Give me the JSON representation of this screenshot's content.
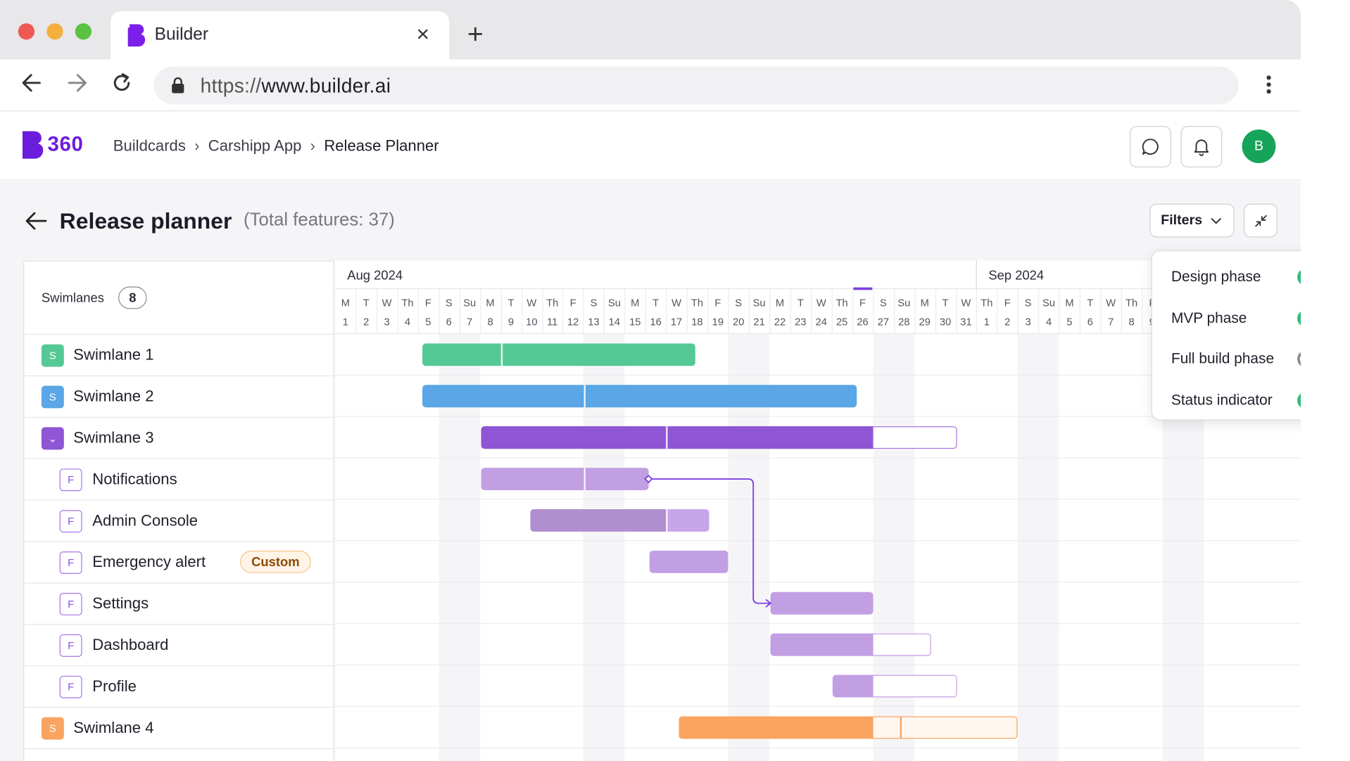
{
  "browser": {
    "tab_title": "Builder",
    "close_glyph": "×",
    "new_tab_glyph": "+",
    "url_scheme": "https://",
    "url_host": "www.builder.ai"
  },
  "app": {
    "brand_text": "360",
    "breadcrumb": [
      "Buildcards",
      "Carshipp App",
      "Release Planner"
    ],
    "avatar_initial": "B",
    "accent_color": "#6c1ddc"
  },
  "page": {
    "title": "Release planner",
    "subtitle": "(Total features: 37)",
    "filters_label": "Filters"
  },
  "lanes": {
    "header_label": "Swimlanes",
    "count": "8",
    "rows": [
      {
        "label": "Swimlane 1",
        "badge": "S",
        "kind": "lane",
        "color": "#55c995"
      },
      {
        "label": "Swimlane 2",
        "badge": "S",
        "kind": "lane",
        "color": "#5aa6e6"
      },
      {
        "label": "Swimlane 3",
        "badge": "⌄",
        "kind": "lane-expanded",
        "color": "#8e55d4"
      },
      {
        "label": "Notifications",
        "badge": "F",
        "kind": "feature"
      },
      {
        "label": "Admin Console",
        "badge": "F",
        "kind": "feature"
      },
      {
        "label": "Emergency alert",
        "badge": "F",
        "kind": "feature",
        "tag": "Custom"
      },
      {
        "label": "Settings",
        "badge": "F",
        "kind": "feature"
      },
      {
        "label": "Dashboard",
        "badge": "F",
        "kind": "feature"
      },
      {
        "label": "Profile",
        "badge": "F",
        "kind": "feature"
      },
      {
        "label": "Swimlane 4",
        "badge": "S",
        "kind": "lane",
        "color": "#f9a460"
      }
    ]
  },
  "timeline": {
    "months": [
      {
        "label": "Aug 2024",
        "start_index": 0
      },
      {
        "label": "Sep 2024",
        "start_index": 31
      }
    ],
    "weekdays": [
      "M",
      "T",
      "W",
      "Th",
      "F",
      "S",
      "Su",
      "M",
      "T",
      "W",
      "Th",
      "F",
      "S",
      "Su",
      "M",
      "T",
      "W",
      "Th",
      "F",
      "S",
      "Su",
      "M",
      "T",
      "W",
      "Th",
      "F",
      "S",
      "Su",
      "M",
      "T",
      "W",
      "Th",
      "F",
      "S",
      "Su",
      "M",
      "T",
      "W",
      "Th",
      "F"
    ],
    "day_numbers": [
      "1",
      "2",
      "3",
      "4",
      "5",
      "6",
      "7",
      "8",
      "9",
      "10",
      "11",
      "12",
      "13",
      "14",
      "15",
      "16",
      "17",
      "18",
      "19",
      "20",
      "21",
      "22",
      "23",
      "24",
      "25",
      "26",
      "27",
      "28",
      "29",
      "30",
      "31",
      "1",
      "2",
      "3",
      "4",
      "5",
      "6",
      "7",
      "8",
      "9"
    ],
    "today_index": 25,
    "weekend_indices": [
      5,
      12,
      19,
      26,
      33,
      40
    ],
    "bars": [
      {
        "row": 0,
        "start_day": 4.2,
        "end_day": 17.4,
        "color": "#55c995",
        "split_days": [
          8.05
        ]
      },
      {
        "row": 1,
        "start_day": 4.2,
        "end_day": 25.2,
        "color": "#5aa6e6",
        "split_days": [
          12.05
        ]
      },
      {
        "row": 2,
        "start_day": 7.05,
        "end_day": 26.0,
        "color": "#8e55d4",
        "split_days": [
          16.05
        ],
        "outline_end_day": 30.05,
        "outline_color": "#a774e8"
      },
      {
        "row": 3,
        "start_day": 7.05,
        "end_day": 15.15,
        "color": "#c29fe3",
        "split_days": [
          12.05
        ]
      },
      {
        "row": 4,
        "start_day": 9.45,
        "end_day": 18.1,
        "color": "#b18ecf",
        "split_days": [
          16.05
        ],
        "tail_color": "#c7a5e8"
      },
      {
        "row": 5,
        "start_day": 15.2,
        "end_day": 19.0,
        "color": "#c29fe3"
      },
      {
        "row": 6,
        "start_day": 21.05,
        "end_day": 26.0,
        "color": "#c29fe3"
      },
      {
        "row": 7,
        "start_day": 21.05,
        "end_day": 26.0,
        "color": "#c29fe3",
        "outline_end_day": 28.8,
        "outline_color": "#c29fe3"
      },
      {
        "row": 8,
        "start_day": 24.05,
        "end_day": 26.0,
        "color": "#c29fe3",
        "outline_end_day": 30.05,
        "outline_color": "#c29fe3"
      },
      {
        "row": 9,
        "start_day": 16.6,
        "end_day": 26.0,
        "color": "#f9a460",
        "outline_end_day": 32.98,
        "outline_color": "#f9a460",
        "split_days": [
          27.35
        ]
      }
    ]
  },
  "filter_panel": {
    "items": [
      {
        "label": "Design phase",
        "on": true
      },
      {
        "label": "MVP phase",
        "on": true
      },
      {
        "label": "Full build phase",
        "on": false
      },
      {
        "label": "Status indicator",
        "on": true
      }
    ],
    "on_color": "#2fbd78",
    "off_color": "#8a8a94"
  }
}
